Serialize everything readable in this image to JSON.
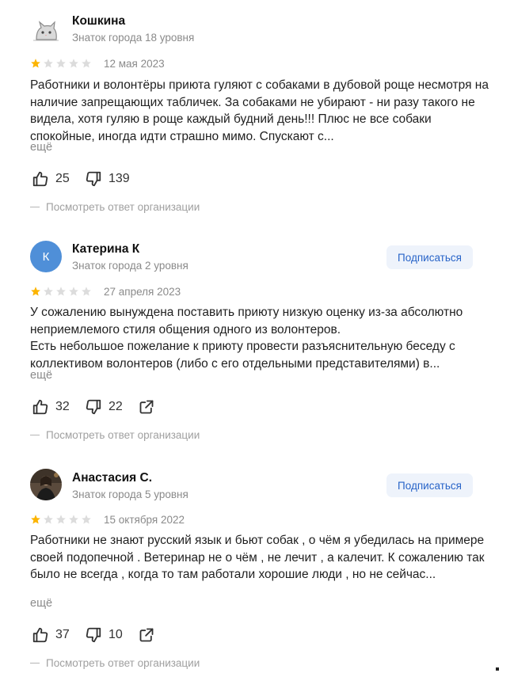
{
  "reviews": [
    {
      "author": "Кошкина",
      "level": "Знаток города 18 уровня",
      "avatar_type": "cat-picture",
      "avatar_letter": "",
      "rating": 1,
      "rating_max": 5,
      "date": "12 мая 2023",
      "text": "Работники и волонтёры приюта гуляют с собаками в дубовой роще несмотря на наличие запрещающих табличек. За собаками не убирают - ни разу такого не видела, хотя гуляю в роще каждый будний день!!! Плюс не все собаки спокойные, иногда идти страшно мимо. Спускают с...",
      "more": "ещё",
      "likes": "25",
      "dislikes": "139",
      "subscribe": "",
      "org_answer": "Посмотреть ответ организации"
    },
    {
      "author": "Катерина К",
      "level": "Знаток города 2 уровня",
      "avatar_type": "letter",
      "avatar_letter": "К",
      "rating": 1,
      "rating_max": 5,
      "date": "27 апреля 2023",
      "text": "У сожалению вынуждена поставить приюту низкую оценку из-за абсолютно неприемлемого стиля общения одного из волонтеров.\nЕсть небольшое пожелание к приюту провести разъяснительную беседу с коллективом волонтеров (либо с его отдельными представителями) в...",
      "more": "ещё",
      "likes": "32",
      "dislikes": "22",
      "subscribe": "Подписаться",
      "org_answer": "Посмотреть ответ организации"
    },
    {
      "author": "Анастасия С.",
      "level": "Знаток города 5 уровня",
      "avatar_type": "photo",
      "avatar_letter": "",
      "rating": 1,
      "rating_max": 5,
      "date": "15 октября 2022",
      "text": "Работники не знают русский язык и бьют собак , о чём я убедилась на примере своей подопечной . Ветеринар не о чём , не лечит , а калечит. К сожалению так было не всегда , когда то там работали хорошие люди , но не сейчас...",
      "more": "ещё",
      "likes": "37",
      "dislikes": "10",
      "subscribe": "Подписаться",
      "org_answer": "Посмотреть ответ организации"
    }
  ],
  "colors": {
    "star_filled": "#fcb400",
    "star_empty": "#dcdcdc",
    "subscribe_bg": "#eef3fb",
    "subscribe_text": "#2864c8",
    "avatar_letter_bg": "#4f8fd8",
    "muted_text": "#8a8a8a"
  },
  "icons": {
    "like": "thumbs-up-icon",
    "dislike": "thumbs-down-icon",
    "share": "share-icon",
    "star": "star-icon"
  }
}
